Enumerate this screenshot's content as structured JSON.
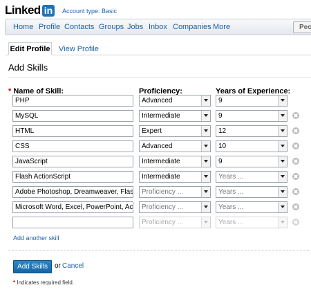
{
  "header": {
    "logo_text": "Linked",
    "logo_in": "in",
    "account_type": "Account type: Basic"
  },
  "nav": {
    "items": [
      "Home",
      "Profile",
      "Contacts",
      "Groups",
      "Jobs",
      "Inbox",
      "Companies",
      "More"
    ],
    "search_value": "People"
  },
  "tabs": {
    "edit": "Edit Profile",
    "view": "View Profile"
  },
  "page_title": "Add Skills",
  "columns": {
    "required_mark": "*",
    "name": "Name of Skill:",
    "proficiency": "Proficiency:",
    "years": "Years of Experience:"
  },
  "skills": [
    {
      "name": "PHP",
      "proficiency": "Advanced",
      "years": "9",
      "removable": false
    },
    {
      "name": "MySQL",
      "proficiency": "Intermediate",
      "years": "9",
      "removable": true
    },
    {
      "name": "HTML",
      "proficiency": "Expert",
      "years": "12",
      "removable": true
    },
    {
      "name": "CSS",
      "proficiency": "Advanced",
      "years": "10",
      "removable": true
    },
    {
      "name": "JavaScript",
      "proficiency": "Intermediate",
      "years": "9",
      "removable": true
    },
    {
      "name": "Flash ActionScript",
      "proficiency": "Intermediate",
      "years": "Years ...",
      "removable": true
    },
    {
      "name": "Adobe Photoshop, Dreamweaver, Flash, A",
      "proficiency": "Proficiency ...",
      "years": "Years ...",
      "removable": true
    },
    {
      "name": "Microsoft Word, Excel, PowerPoint, Acces",
      "proficiency": "Proficiency ...",
      "years": "Years ...",
      "removable": true
    },
    {
      "name": "",
      "proficiency": "Proficiency ...",
      "years": "Years ...",
      "removable": true,
      "disabled": true
    }
  ],
  "add_another": "Add another skill",
  "buttons": {
    "add_skills": "Add Skills",
    "or": "or",
    "cancel": "Cancel"
  },
  "required_note": "Indicates required field.",
  "colors": {
    "link": "#1d62a6",
    "button": "#1e74b8",
    "required": "#cc0000"
  }
}
